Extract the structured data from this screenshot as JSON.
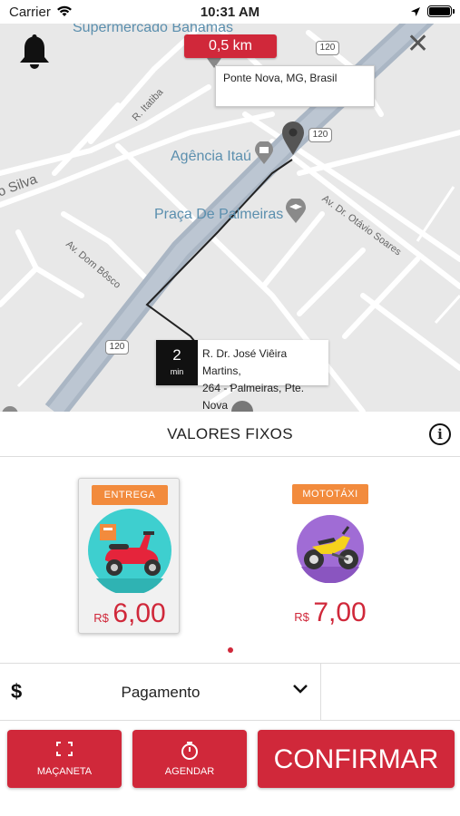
{
  "status_bar": {
    "carrier": "Carrier",
    "time": "10:31 AM"
  },
  "map": {
    "poi_labels": [
      "Supermercado Bahamas",
      "Agência Itaú",
      "Praça De Palmeiras"
    ],
    "street_labels": [
      "R. Itatiba",
      "Av. Dr. Otávio Soares",
      "Av. Dom Bôsco",
      "o Silva"
    ],
    "highway_shields": [
      "120",
      "120",
      "120"
    ],
    "distance": "0,5 km",
    "destination": "Ponte Nova, MG, Brasil",
    "origin": {
      "eta_value": "2",
      "eta_unit": "min",
      "address_line1": "R. Dr. José Viêira Martins,",
      "address_line2": "264 - Palmeiras, Pte. Nova"
    },
    "route_color": "#222222"
  },
  "valores_fixos": {
    "title": "VALORES FIXOS",
    "info_glyph": "i"
  },
  "services": [
    {
      "tag": "ENTREGA",
      "currency": "R$",
      "price": "6,00",
      "icon": "scooter-icon",
      "selected": true
    },
    {
      "tag": "MOTOTÁXI",
      "currency": "R$",
      "price": "7,00",
      "icon": "motorcycle-icon",
      "selected": false
    }
  ],
  "payment": {
    "currency_glyph": "$",
    "label": "Pagamento"
  },
  "buttons": {
    "macaneta": "MAÇANETA",
    "agendar": "AGENDAR",
    "confirmar": "CONFIRMAR"
  },
  "colors": {
    "accent": "#d0283a",
    "tag": "#f28b3d",
    "map_bg": "#e8e8e8",
    "road": "#ffffff",
    "highway": "#aab6c4"
  }
}
